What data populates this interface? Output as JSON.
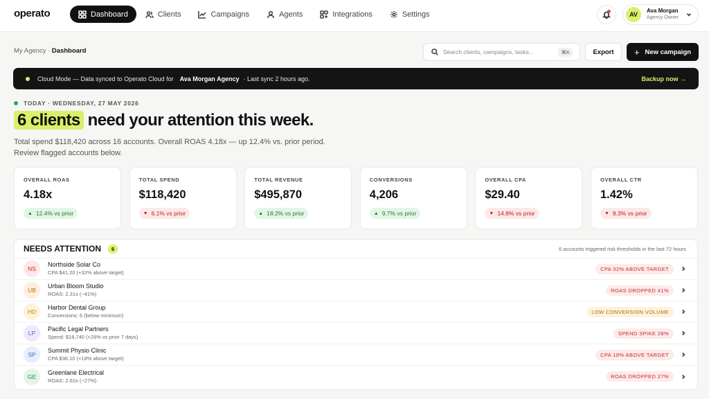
{
  "app": {
    "name": "operato"
  },
  "nav": [
    {
      "label": "Dashboard",
      "icon": "grid-icon",
      "active": true
    },
    {
      "label": "Clients",
      "icon": "users-icon"
    },
    {
      "label": "Campaigns",
      "icon": "chart-line-icon"
    },
    {
      "label": "Agents",
      "icon": "agent-icon"
    },
    {
      "label": "Integrations",
      "icon": "apps-icon"
    },
    {
      "label": "Settings",
      "icon": "gear-icon"
    }
  ],
  "user": {
    "initials": "AV",
    "name": "Ava Morgan",
    "role": "Agency Owner"
  },
  "breadcrumb": {
    "parent": "My Agency",
    "separator": "·",
    "current": "Dashboard"
  },
  "search": {
    "placeholder": "Search clients, campaigns, tasks...",
    "shortcut": "⌘K"
  },
  "actions": {
    "export_label": "Export",
    "new_campaign_label": "New campaign",
    "new_campaign_plus": "+"
  },
  "banner": {
    "prefix": "Cloud Mode — Data synced to Operato Cloud for",
    "agency": "Ava Morgan Agency",
    "suffix": "· Last sync 2 hours ago.",
    "action": "Backup now →"
  },
  "today": {
    "label": "TODAY · WEDNESDAY, 27 MAY 2026"
  },
  "headline": {
    "highlight": "6 clients",
    "rest": "need your attention this week."
  },
  "summary": "Total spend $118,420 across 16 accounts. Overall ROAS 4.18x — up 12.4% vs. prior period. Review flagged accounts below.",
  "kpis": [
    {
      "label": "OVERALL ROAS",
      "value": "4.18x",
      "delta": "12.4% vs prior",
      "dir": "up"
    },
    {
      "label": "TOTAL SPEND",
      "value": "$118,420",
      "delta": "6.1% vs prior",
      "dir": "down"
    },
    {
      "label": "TOTAL REVENUE",
      "value": "$495,870",
      "delta": "18.2% vs prior",
      "dir": "up"
    },
    {
      "label": "CONVERSIONS",
      "value": "4,206",
      "delta": "9.7% vs prior",
      "dir": "up"
    },
    {
      "label": "OVERALL CPA",
      "value": "$29.40",
      "delta": "14.8% vs prior",
      "dir": "down"
    },
    {
      "label": "OVERALL CTR",
      "value": "1.42%",
      "delta": "8.3% vs prior",
      "dir": "down"
    }
  ],
  "attention": {
    "title": "NEEDS ATTENTION",
    "count": "6",
    "note": "6 accounts triggered risk thresholds in the last 72 hours",
    "rows": [
      {
        "initials": "NS",
        "name": "Northside Solar Co",
        "detail": "CPA $41.20 (+32% above target)",
        "tag": "CPA 32% ABOVE TARGET",
        "tag_tone": "red",
        "avatar_bg": "#fde8e8",
        "avatar_fg": "#c52a2a"
      },
      {
        "initials": "UB",
        "name": "Urban Bloom Studio",
        "detail": "ROAS: 2.31x (−41%)",
        "tag": "ROAS DROPPED 41%",
        "tag_tone": "red",
        "avatar_bg": "#fdeedd",
        "avatar_fg": "#c2700e"
      },
      {
        "initials": "HD",
        "name": "Harbor Dental Group",
        "detail": "Conversions: 6 (below minimum)",
        "tag": "LOW CONVERSION VOLUME",
        "tag_tone": "amber",
        "avatar_bg": "#fdf4d8",
        "avatar_fg": "#b88a00"
      },
      {
        "initials": "LP",
        "name": "Pacific Legal Partners",
        "detail": "Spend: $18,740 (+28% vs prior 7 days)",
        "tag": "SPEND SPIKE 28%",
        "tag_tone": "red",
        "avatar_bg": "#efe8fb",
        "avatar_fg": "#7a4fc4"
      },
      {
        "initials": "SP",
        "name": "Summit Physio Clinic",
        "detail": "CPA $36.10 (+18% above target)",
        "tag": "CPA 18% ABOVE TARGET",
        "tag_tone": "red",
        "avatar_bg": "#e6eefb",
        "avatar_fg": "#3768c2"
      },
      {
        "initials": "GE",
        "name": "Greenlane Electrical",
        "detail": "ROAS: 2.62x (−27%)",
        "tag": "ROAS DROPPED 27%",
        "tag_tone": "red",
        "avatar_bg": "#e3f4e8",
        "avatar_fg": "#2a8a4a"
      }
    ]
  },
  "colors": {
    "accent": "#d9f06a",
    "ink": "#111111",
    "up": "#1f7a34",
    "down": "#b42323",
    "banner": "#141414"
  }
}
